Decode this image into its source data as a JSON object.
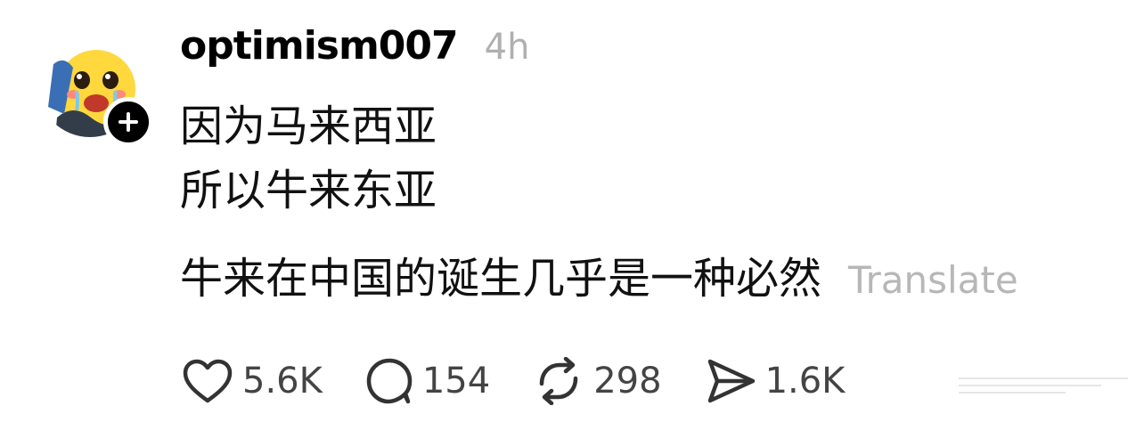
{
  "post": {
    "username": "optimism007",
    "time": "4h",
    "lines": [
      "因为马来西亚",
      "所以牛来东亚",
      "牛来在中国的诞生几乎是一种必然"
    ],
    "translate_label": "Translate"
  },
  "actions": {
    "likes": "5.6K",
    "replies": "154",
    "reposts": "298",
    "shares": "1.6K"
  },
  "icons": [
    "heart-icon",
    "comment-icon",
    "repost-icon",
    "send-icon",
    "plus-icon"
  ],
  "colors": {
    "text": "#000000",
    "muted": "#b0b0b0",
    "icon": "#333333"
  }
}
